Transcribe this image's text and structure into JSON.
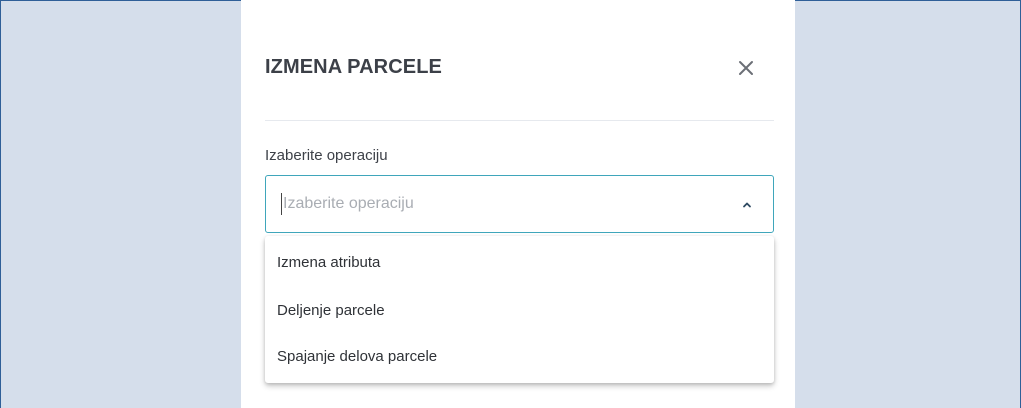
{
  "modal": {
    "title": "IZMENA PARCELE",
    "close_icon": "close-icon"
  },
  "operation_field": {
    "label": "Izaberite operaciju",
    "placeholder": "Izaberite operaciju",
    "value": "",
    "chevron_icon": "chevron-up-icon",
    "options": [
      {
        "label": "Izmena atributa"
      },
      {
        "label": "Deljenje parcele"
      },
      {
        "label": "Spajanje delova parcele"
      }
    ]
  },
  "colors": {
    "backdrop": "#d5deeb",
    "frame_border": "#2f5f98",
    "input_focus_border": "#3fa6bb",
    "title_text": "#3c4048"
  }
}
